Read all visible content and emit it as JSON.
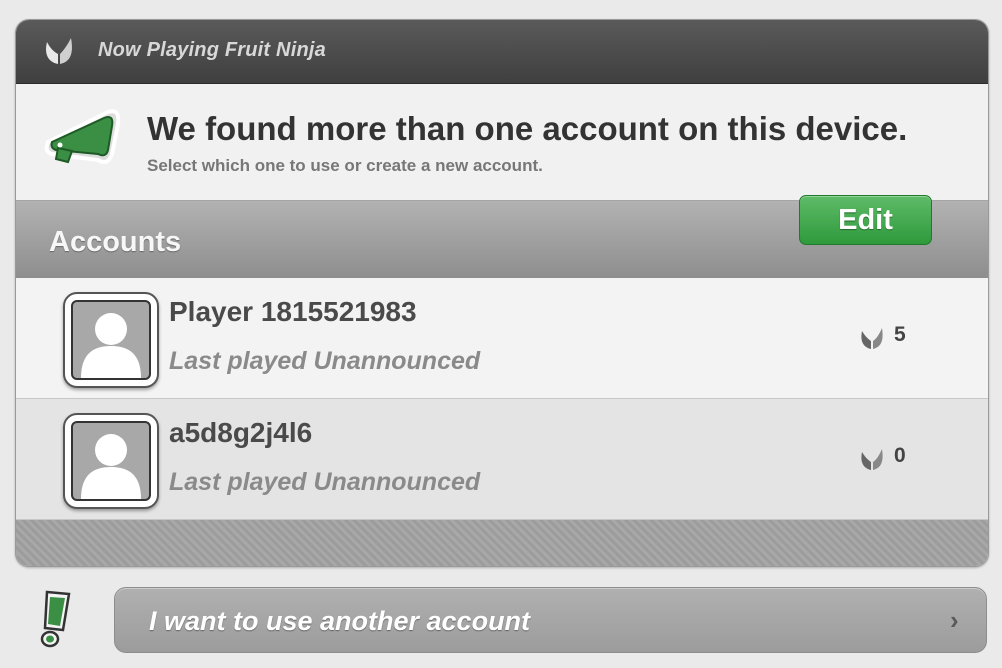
{
  "header": {
    "title": "Now Playing Fruit Ninja",
    "logo_icon": "leaf-logo-icon"
  },
  "notice": {
    "icon": "megaphone-icon",
    "headline": "We found more than one account on this device.",
    "subtext": "Select which one to use or create a new account."
  },
  "accounts": {
    "heading": "Accounts",
    "edit_label": "Edit",
    "items": [
      {
        "name": "Player 1815521983",
        "last_played": "Last played Unannounced",
        "score": "5"
      },
      {
        "name": "a5d8g2j4l6",
        "last_played": "Last played Unannounced",
        "score": "0"
      }
    ]
  },
  "footer": {
    "icon": "exclamation-icon",
    "another_account_label": "I want to use another account",
    "chevron": "›"
  },
  "colors": {
    "accent_green": "#3aa346",
    "titlebar": "#4a4a4a"
  }
}
